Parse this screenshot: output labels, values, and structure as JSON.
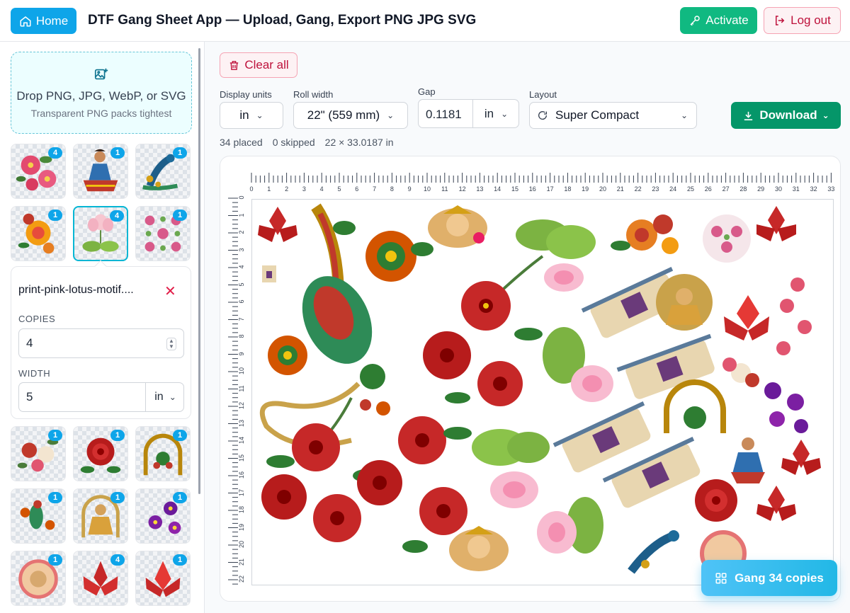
{
  "header": {
    "home_label": "Home",
    "title": "DTF Gang Sheet App — Upload, Gang, Export PNG JPG SVG",
    "activate_label": "Activate",
    "logout_label": "Log out"
  },
  "dropzone": {
    "title": "Drop PNG, JPG, WebP, or SVG",
    "subtitle": "Transparent PNG packs tightest"
  },
  "thumbnails": [
    {
      "name": "pink-hibiscus",
      "copies": "4"
    },
    {
      "name": "dancing-lady",
      "copies": "1"
    },
    {
      "name": "peacock",
      "copies": "1"
    },
    {
      "name": "orange-marigold",
      "copies": "1"
    },
    {
      "name": "pink-lotus-motif",
      "copies": "4",
      "selected": true
    },
    {
      "name": "floral-pattern",
      "copies": "1"
    },
    {
      "name": "rose-bouquet",
      "copies": "1"
    },
    {
      "name": "red-rose",
      "copies": "1"
    },
    {
      "name": "peacock-arch",
      "copies": "1"
    },
    {
      "name": "parrot-vine",
      "copies": "1"
    },
    {
      "name": "lakshmi-goddess",
      "copies": "1"
    },
    {
      "name": "purple-pansies",
      "copies": "1"
    },
    {
      "name": "krishna-medallion",
      "copies": "1"
    },
    {
      "name": "red-lotus",
      "copies": "4"
    },
    {
      "name": "crimson-lotus",
      "copies": "1"
    }
  ],
  "editor": {
    "filename": "print-pink-lotus-motif....",
    "close_icon": "✕",
    "copies_label": "COPIES",
    "copies_value": "4",
    "width_label": "WIDTH",
    "width_value": "5",
    "width_unit": "in"
  },
  "toolbar": {
    "clear_label": "Clear all",
    "display_units_label": "Display units",
    "display_units_value": "in",
    "roll_width_label": "Roll width",
    "roll_width_value": "22\" (559 mm)",
    "gap_label": "Gap",
    "gap_value": "0.1181",
    "gap_unit": "in",
    "layout_label": "Layout",
    "layout_value": "Super Compact",
    "download_label": "Download"
  },
  "stats": {
    "placed": "34 placed",
    "skipped": "0 skipped",
    "size": "22 × 33.0187 in"
  },
  "ruler": {
    "horizontal": [
      "0",
      "1",
      "2",
      "3",
      "4",
      "5",
      "6",
      "7",
      "8",
      "9",
      "10",
      "11",
      "12",
      "13",
      "14",
      "15",
      "16",
      "17",
      "18",
      "19",
      "20",
      "21",
      "22",
      "23",
      "24",
      "25",
      "26",
      "27",
      "28",
      "29",
      "30",
      "31",
      "32",
      "33"
    ],
    "vertical": [
      "0",
      "1",
      "2",
      "3",
      "4",
      "5",
      "6",
      "7",
      "8",
      "9",
      "10",
      "11",
      "12",
      "13",
      "14",
      "15",
      "16",
      "17",
      "18",
      "19",
      "20",
      "21",
      "22"
    ]
  },
  "gang_button_label": "Gang 34 copies",
  "colors": {
    "home": "#0ea5e9",
    "activate": "#10b981",
    "danger": "#be123c",
    "download": "#059669",
    "selected_border": "#06b6d4"
  }
}
